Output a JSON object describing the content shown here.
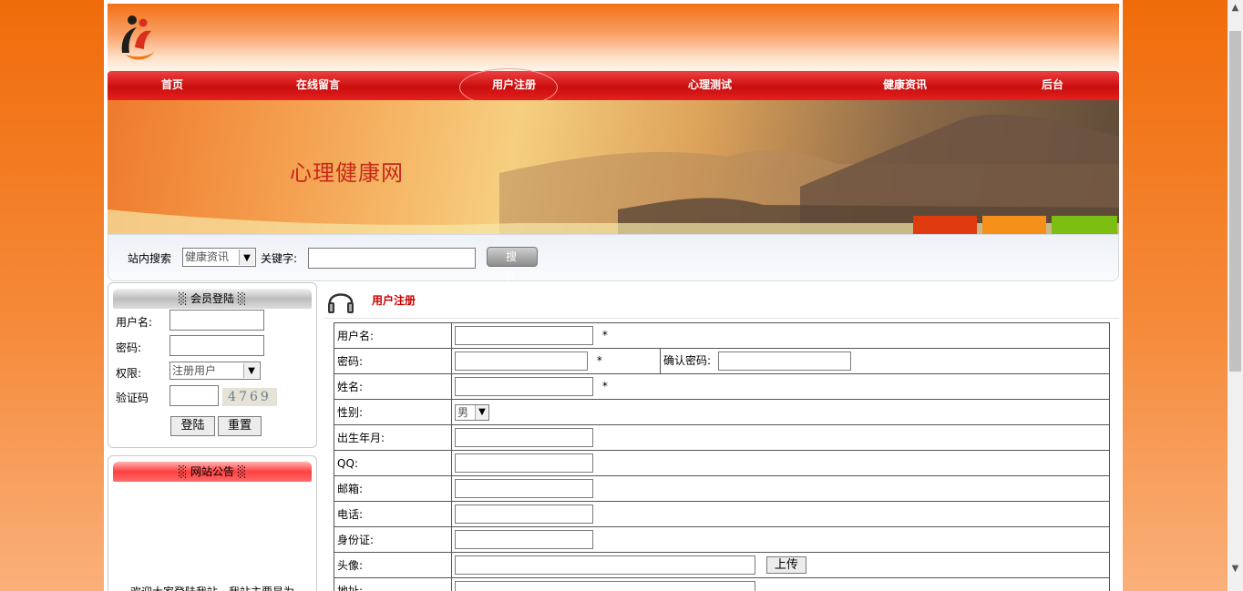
{
  "nav": {
    "items": [
      "首页",
      "在线留言",
      "用户注册",
      "心理测试",
      "健康资讯",
      "后台"
    ],
    "active": "用户注册"
  },
  "banner": {
    "title": "心理健康网"
  },
  "search": {
    "site_search_label": "站内搜索",
    "category_value": "健康资讯",
    "keyword_label": "关键字:",
    "button_label": "搜 索"
  },
  "login": {
    "title": "会员登陆",
    "username_label": "用户名:",
    "password_label": "密码:",
    "role_label": "权限:",
    "role_value": "注册用户",
    "captcha_label": "验证码",
    "captcha_text": "4769",
    "login_button": "登陆",
    "reset_button": "重置"
  },
  "notice": {
    "title": "网站公告",
    "text": "欢迎大家登陆我站，我站主要是为"
  },
  "register": {
    "title": "用户注册",
    "fields": {
      "username": "用户名:",
      "password": "密码:",
      "confirm_password": "确认密码:",
      "name": "姓名:",
      "gender": "性别:",
      "gender_value": "男",
      "birth": "出生年月:",
      "qq": "QQ:",
      "email": "邮箱:",
      "phone": "电话:",
      "id_card": "身份证:",
      "avatar": "头像:",
      "upload_button": "上传",
      "address": "地址:"
    },
    "required_mark": "*"
  },
  "colors": {
    "page_bg": "#f06c0a",
    "nav_red": "#c90d0d",
    "title_red": "#cc0000"
  }
}
